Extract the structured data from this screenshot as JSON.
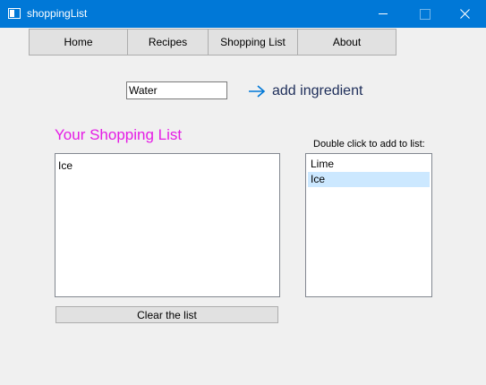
{
  "window": {
    "title": "shoppingList"
  },
  "nav": {
    "tabs": [
      {
        "label": "Home"
      },
      {
        "label": "Recipes"
      },
      {
        "label": "Shopping List"
      },
      {
        "label": "About"
      }
    ]
  },
  "ingredient": {
    "value": "Water",
    "add_label": "add ingredient"
  },
  "shopping_list": {
    "title": "Your Shopping List",
    "items": [
      "Ice"
    ]
  },
  "suggestions": {
    "label": "Double click to add to list:",
    "items": [
      "Lime",
      "Ice"
    ],
    "selected": "Ice"
  },
  "actions": {
    "clear_label": "Clear the list"
  },
  "colors": {
    "titlebar": "#0078d7",
    "list_title": "#e51ce5",
    "arrow": "#0078d7",
    "selection": "#cce8ff"
  },
  "icons": {
    "app": "window-icon",
    "add": "arrow-right-icon"
  }
}
